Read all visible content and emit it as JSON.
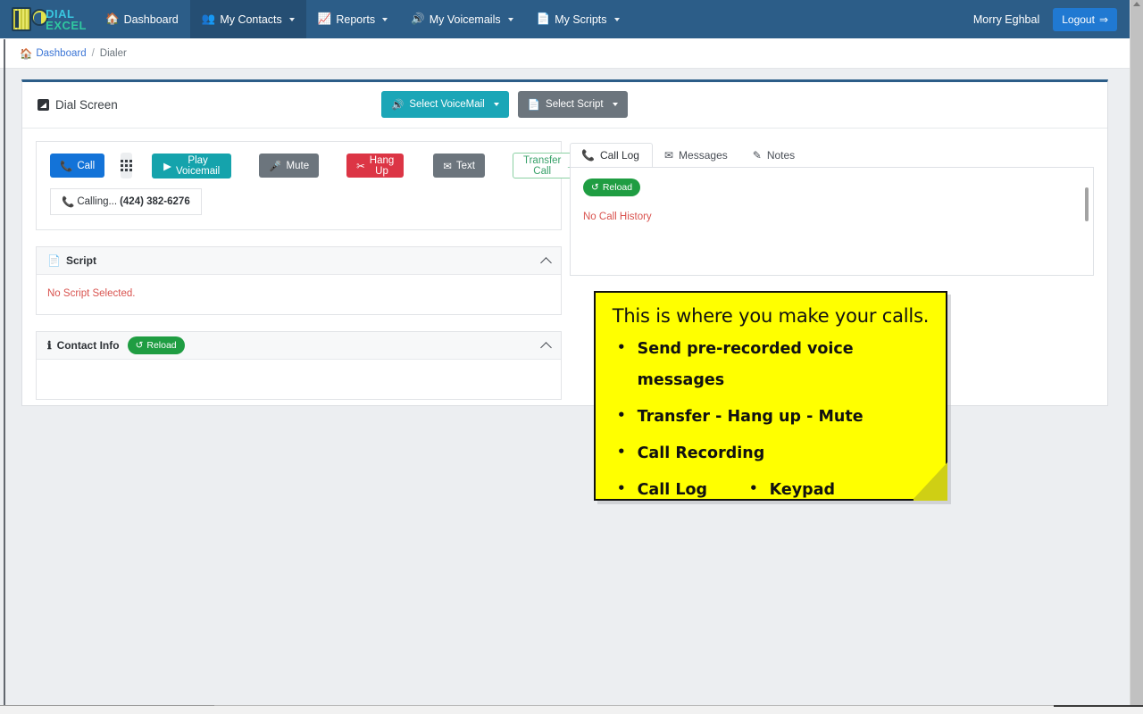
{
  "navbar": {
    "logo": {
      "line1": "DIAL",
      "line2": "EXCEL",
      "icon": "dial-excel-logo-icon"
    },
    "items": [
      {
        "label": "Dashboard",
        "icon": "home-icon",
        "caret": false,
        "active": false
      },
      {
        "label": "My Contacts",
        "icon": "users-icon",
        "caret": true,
        "active": true
      },
      {
        "label": "Reports",
        "icon": "chart-icon",
        "caret": true,
        "active": false
      },
      {
        "label": "My Voicemails",
        "icon": "volume-icon",
        "caret": true,
        "active": false
      },
      {
        "label": "My Scripts",
        "icon": "file-icon",
        "caret": true,
        "active": false
      }
    ],
    "user_name": "Morry Eghbal",
    "logout_label": "Logout",
    "logout_icon": "sign-out-icon",
    "bg_color": "#2c5d88",
    "active_bg_color": "#254e73",
    "logout_color": "#2079d2"
  },
  "breadcrumb": {
    "home_label": "Dashboard",
    "home_icon": "home-icon",
    "separator": "/",
    "current_label": "Dialer"
  },
  "card": {
    "title": "Dial Screen",
    "title_icon": "dial-screen-icon",
    "accent_color": "#2c5d88",
    "actions": [
      {
        "label": "Select VoiceMail",
        "icon": "volume-icon",
        "color": "#1ba6b7",
        "style": "teal"
      },
      {
        "label": "Select Script",
        "icon": "file-icon",
        "color": "#6c757d",
        "style": "gray"
      }
    ]
  },
  "call_controls": {
    "buttons": [
      {
        "label": "Call",
        "icon": "phone-icon",
        "style": "blue",
        "color": "#1373d8"
      },
      {
        "label": "",
        "icon": "keypad-icon",
        "style": "keypad",
        "color": "#eceef0"
      },
      {
        "label": "Play Voicemail",
        "icon": "play-icon",
        "style": "teal",
        "color": "#15a3ac"
      },
      {
        "label": "Mute",
        "icon": "microphone-icon",
        "style": "gray",
        "color": "#6c757d"
      },
      {
        "label": "Hang Up",
        "icon": "phone-hangup-icon",
        "style": "red",
        "color": "#dc3545"
      },
      {
        "label": "Text",
        "icon": "envelope-icon",
        "style": "gray",
        "color": "#6c757d"
      },
      {
        "label": "Transfer Call",
        "icon": "arrow-right-icon",
        "style": "outline-green",
        "color": "#38a169"
      }
    ],
    "status_icon": "phone-ringing-icon",
    "status_label": "Calling...",
    "status_number": "(424) 382-6276"
  },
  "script_panel": {
    "title": "Script",
    "title_icon": "file-icon",
    "collapse_icon": "chevron-up-icon",
    "empty_message": "No Script Selected.",
    "empty_color": "#d9534f"
  },
  "contact_panel": {
    "title": "Contact Info",
    "title_icon": "info-circle-icon",
    "reload_label": "Reload",
    "reload_icon": "reload-icon",
    "reload_color": "#1f9d42",
    "collapse_icon": "chevron-up-icon",
    "body_text": ""
  },
  "right_panel": {
    "tabs": [
      {
        "label": "Call Log",
        "icon": "phone-icon",
        "active": true
      },
      {
        "label": "Messages",
        "icon": "envelope-icon",
        "active": false
      },
      {
        "label": "Notes",
        "icon": "edit-icon",
        "active": false
      }
    ],
    "reload_label": "Reload",
    "reload_icon": "reload-icon",
    "empty_message": "No Call History",
    "empty_color": "#d9534f"
  },
  "sticky_note": {
    "title": "This is where you make your calls.",
    "bullets": [
      {
        "text": "Send pre-recorded voice messages",
        "second": null
      },
      {
        "text": "Transfer - Hang up - Mute",
        "second": null
      },
      {
        "text": "Call Recording",
        "second": null
      },
      {
        "text": "Call Log",
        "second": "Keypad"
      }
    ],
    "bullet_glyph": "•",
    "bg_color": "#ffff00",
    "border_color": "#111111",
    "fold_color": "#cfcf14"
  }
}
